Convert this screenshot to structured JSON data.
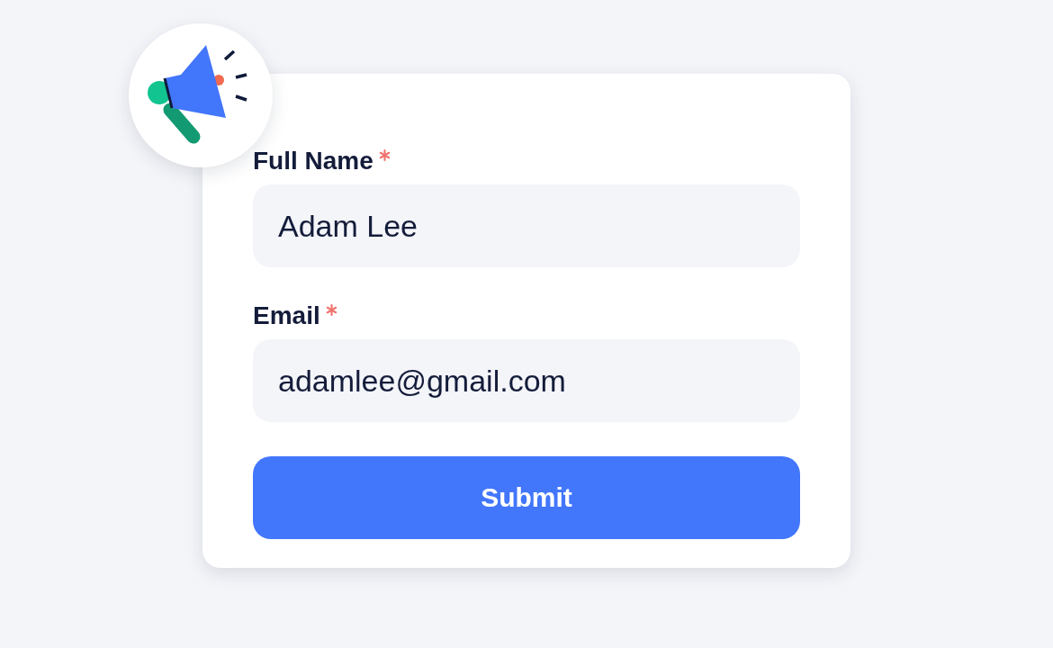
{
  "form": {
    "fields": [
      {
        "label": "Full Name",
        "required": true,
        "value": "Adam Lee"
      },
      {
        "label": "Email",
        "required": true,
        "value": "adamlee@gmail.com"
      }
    ],
    "submit": "Submit"
  }
}
